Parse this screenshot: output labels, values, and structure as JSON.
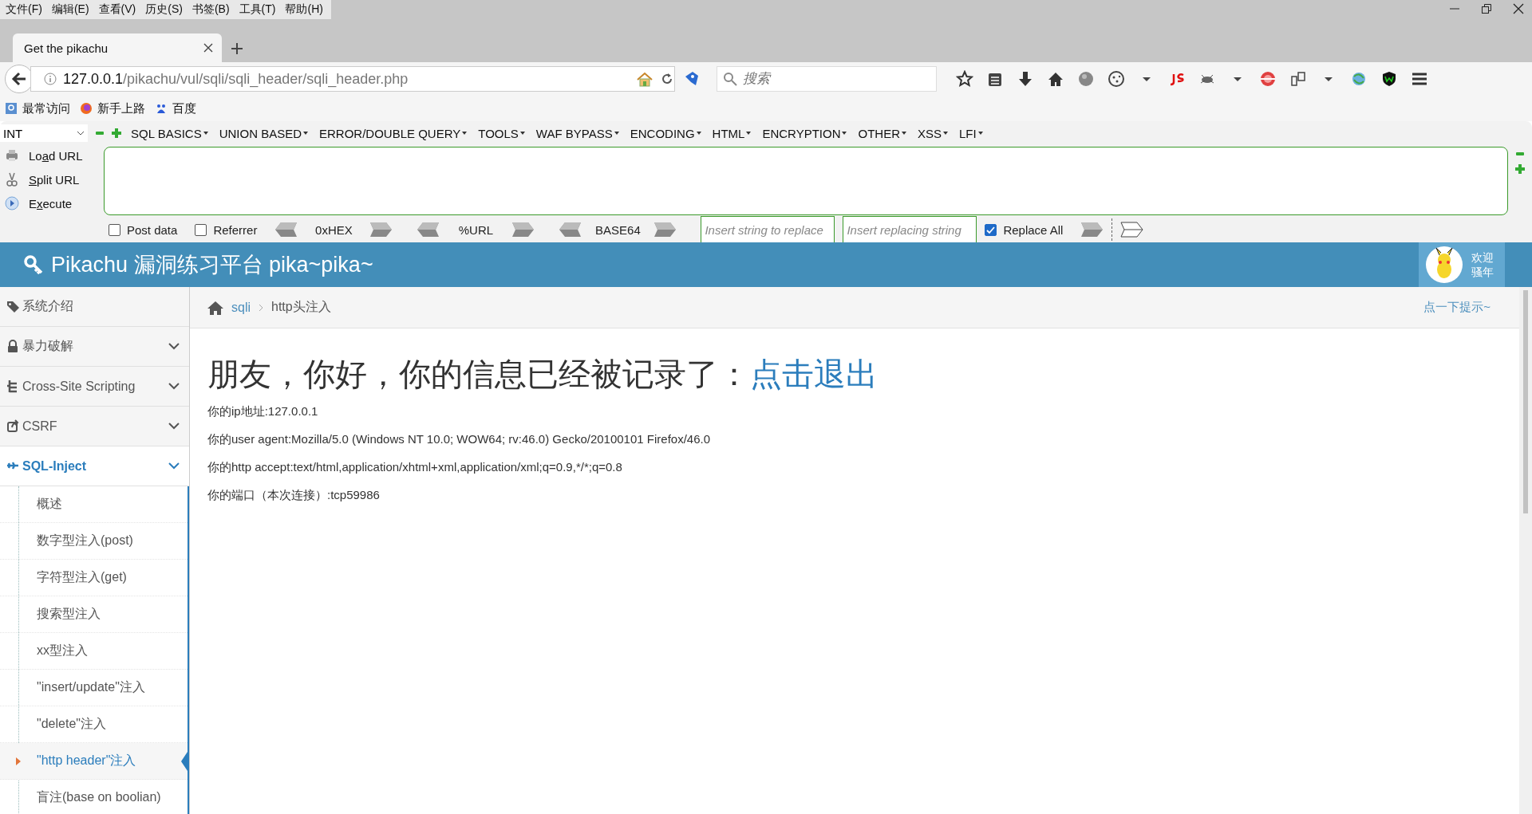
{
  "menu_bar": [
    {
      "label": "文件(F)"
    },
    {
      "label": "编辑(E)"
    },
    {
      "label": "查看(V)"
    },
    {
      "label": "历史(S)"
    },
    {
      "label": "书签(B)"
    },
    {
      "label": "工具(T)"
    },
    {
      "label": "帮助(H)"
    }
  ],
  "tabs": [
    {
      "label": "Get the pikachu",
      "selected": true
    }
  ],
  "address_bar": {
    "url_host": "127.0.0.1",
    "url_path": "/pikachu/vul/sqli/sqli_header/sqli_header.php"
  },
  "search": {
    "placeholder": "搜索"
  },
  "bookmarks": [
    {
      "label": "最常访问",
      "kind": "frequent"
    },
    {
      "label": "新手上路",
      "kind": "firefox"
    },
    {
      "label": "百度",
      "kind": "baidu"
    }
  ],
  "hackbar": {
    "type_select": "INT",
    "menus": [
      {
        "label": "SQL BASICS"
      },
      {
        "label": "UNION BASED"
      },
      {
        "label": "ERROR/DOUBLE QUERY"
      },
      {
        "label": "TOOLS"
      },
      {
        "label": "WAF BYPASS"
      },
      {
        "label": "ENCODING"
      },
      {
        "label": "HTML"
      },
      {
        "label": "ENCRYPTION"
      },
      {
        "label": "OTHER"
      },
      {
        "label": "XSS"
      },
      {
        "label": "LFI"
      }
    ],
    "actions": [
      {
        "kind": "load",
        "before": "Lo",
        "key": "a",
        "after": "d URL"
      },
      {
        "kind": "split",
        "key": "S",
        "after": "plit URL"
      },
      {
        "kind": "execute",
        "before": "E",
        "key": "x",
        "after": "ecute"
      }
    ],
    "options": [
      {
        "label": "Post data",
        "checked": false
      },
      {
        "label": "Referrer",
        "checked": false
      }
    ],
    "encoders": [
      {
        "label": "0xHEX"
      },
      {
        "label": "%URL"
      },
      {
        "label": "BASE64"
      }
    ],
    "replace_from": {
      "placeholder": "Insert string to replace"
    },
    "replace_to": {
      "placeholder": "Insert replacing string"
    },
    "replace_all": {
      "label": "Replace All",
      "checked": true
    }
  },
  "site_header": {
    "title": "Pikachu 漏洞练习平台 pika~pika~",
    "greeting": [
      "欢迎",
      "骚年"
    ]
  },
  "sidebar": {
    "items": [
      {
        "label": "系统介绍",
        "kind": "tag",
        "expandable": false,
        "selected": false
      },
      {
        "label": "暴力破解",
        "kind": "lock",
        "expandable": true,
        "selected": false
      },
      {
        "label": "Cross-Site Scripting",
        "kind": "tree",
        "expandable": true,
        "selected": false
      },
      {
        "label": "CSRF",
        "kind": "share",
        "expandable": true,
        "selected": false
      },
      {
        "label": "SQL-Inject",
        "kind": "plane",
        "expandable": true,
        "selected": true,
        "children": [
          {
            "label": "概述",
            "selected": false
          },
          {
            "label": "数字型注入(post)",
            "selected": false
          },
          {
            "label": "字符型注入(get)",
            "selected": false
          },
          {
            "label": "搜索型注入",
            "selected": false
          },
          {
            "label": "xx型注入",
            "selected": false
          },
          {
            "label": "\"insert/update\"注入",
            "selected": false
          },
          {
            "label": "\"delete\"注入",
            "selected": false
          },
          {
            "label": "\"http header\"注入",
            "selected": true
          },
          {
            "label": "盲注(base on boolian)",
            "selected": false
          }
        ]
      }
    ]
  },
  "breadcrumb": {
    "items": [
      {
        "label": "sqli",
        "link": true
      },
      {
        "label": "http头注入",
        "link": false
      }
    ],
    "hint": "点一下提示~"
  },
  "content": {
    "heading": "朋友，你好，你的信息已经被记录了：",
    "logout_link": "点击退出",
    "lines": [
      "你的ip地址:127.0.0.1",
      "你的user agent:Mozilla/5.0 (Windows NT 10.0; WOW64; rv:46.0) Gecko/20100101 Firefox/46.0",
      "你的http accept:text/html,application/xhtml+xml,application/xml;q=0.9,*/*;q=0.8",
      "你的端口（本次连接）:tcp59986"
    ]
  }
}
